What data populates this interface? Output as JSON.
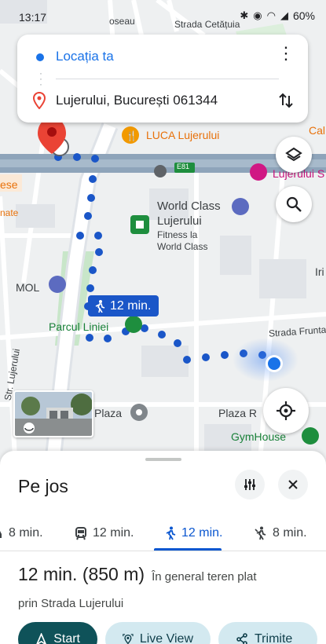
{
  "status_bar": {
    "time": "13:17",
    "battery": "60%"
  },
  "map": {
    "labels": {
      "strada_cetatuia": "Strada Cetățuia",
      "luca": "LUCA Lujerului",
      "lujerului_hotel": "Lujerului S",
      "e81": "E81",
      "world_class_name_1": "World Class",
      "world_class_name_2": "Lujerului",
      "world_class_sub_1": "Fitness la",
      "world_class_sub_2": "World Class",
      "mol": "MOL",
      "parcul_liniei": "Parcul Liniei",
      "strada_fruntas": "Strada Fruntaș",
      "str_lujerului": "Str. Lujerului",
      "plaza": "Plaza",
      "plaza_r": "Plaza R",
      "gymhouse": "GymHouse",
      "ese": "ese",
      "nate": "nate",
      "iri": "Iri",
      "cal": "Cal",
      "oseau": "oseau"
    },
    "duration_chip": "12 min."
  },
  "route_card": {
    "origin": "Locația ta",
    "destination": "Lujerului, București 061344"
  },
  "sheet": {
    "title": "Pe jos",
    "tabs": [
      {
        "label": "8 min.",
        "icon": "car-icon"
      },
      {
        "label": "12 min.",
        "icon": "transit-icon"
      },
      {
        "label": "12 min.",
        "icon": "walk-icon"
      },
      {
        "label": "8 min.",
        "icon": "ride-hailing-icon"
      }
    ],
    "summary": {
      "duration": "12 min. (850 m)",
      "terrain": "În general teren plat",
      "via": "prin Strada Lujerului"
    },
    "actions": {
      "start": "Start",
      "live_view": "Live View",
      "share": "Trimite"
    }
  },
  "colors": {
    "accent": "#1a73e8",
    "route_dots": "#1a56c8",
    "destination_pin": "#ea4335",
    "start_button": "#0f5259",
    "secondary_button": "#d3e9f0"
  }
}
